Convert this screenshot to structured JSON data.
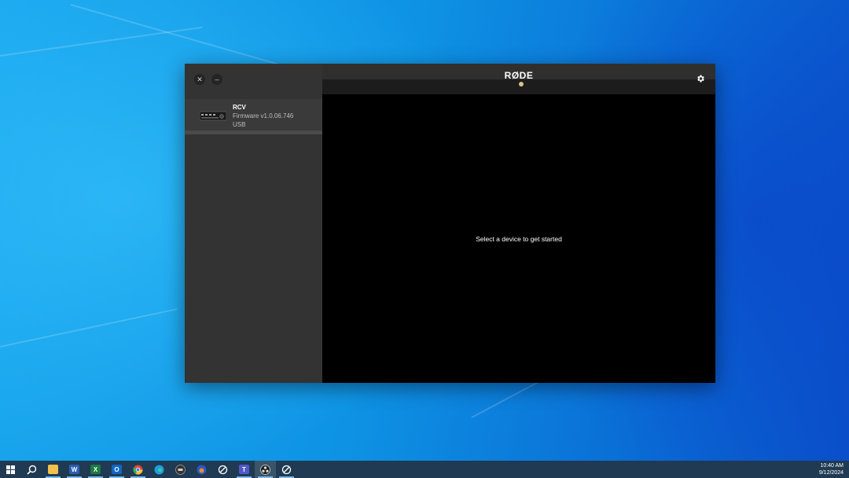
{
  "window": {
    "close_glyph": "✕",
    "minimize_glyph": "–",
    "brand": "RØDE"
  },
  "sidebar": {
    "devices": [
      {
        "name": "RCV",
        "firmware": "Firmware v1.0.06.746",
        "connection": "USB"
      }
    ]
  },
  "main": {
    "empty_message": "Select a device to get started"
  },
  "taskbar": {
    "icons": [
      "windows-start-icon",
      "search-icon",
      "file-explorer-icon",
      "word-icon",
      "excel-icon",
      "outlook-icon",
      "chrome-icon",
      "edge-icon",
      "calculator-icon",
      "browser-icon",
      "rode-app-icon",
      "teams-icon",
      "obs-icon",
      "rode-central-icon"
    ],
    "time": "10:40 AM",
    "date": "9/12/2024"
  },
  "colors": {
    "sidebar": "#333333",
    "main_bg": "#000000",
    "accent_dot": "#d9c28a",
    "taskbar": "#1f3a52"
  }
}
